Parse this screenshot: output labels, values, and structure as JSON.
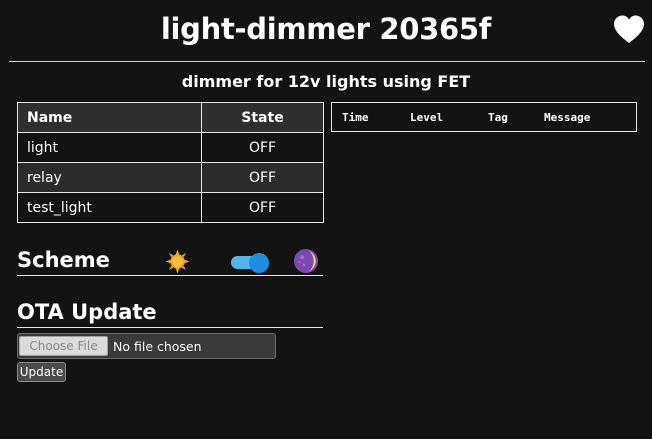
{
  "header": {
    "title": "light-dimmer 20365f",
    "subtitle": "dimmer for 12v lights using FET"
  },
  "entities": {
    "headers": [
      "Name",
      "State"
    ],
    "rows": [
      {
        "name": "light",
        "state": "OFF"
      },
      {
        "name": "relay",
        "state": "OFF"
      },
      {
        "name": "test_light",
        "state": "OFF"
      }
    ]
  },
  "log": {
    "headers": [
      "Time",
      "Level",
      "Tag",
      "Message"
    ]
  },
  "scheme": {
    "title": "Scheme",
    "toggle_on": true,
    "colors": {
      "track": "#53b6ea",
      "knob": "#1d8fe0",
      "sun": "#f0a51e",
      "moon": "#7b4ab0"
    }
  },
  "ota": {
    "title": "OTA Update",
    "choose_label": "Choose File",
    "no_file_text": "No file chosen",
    "update_label": "Update"
  },
  "theme": {
    "background": "#131313",
    "border": "#e6e6e6",
    "header_row": "#2f2f2f",
    "alt_row": "#2b2b2b"
  }
}
